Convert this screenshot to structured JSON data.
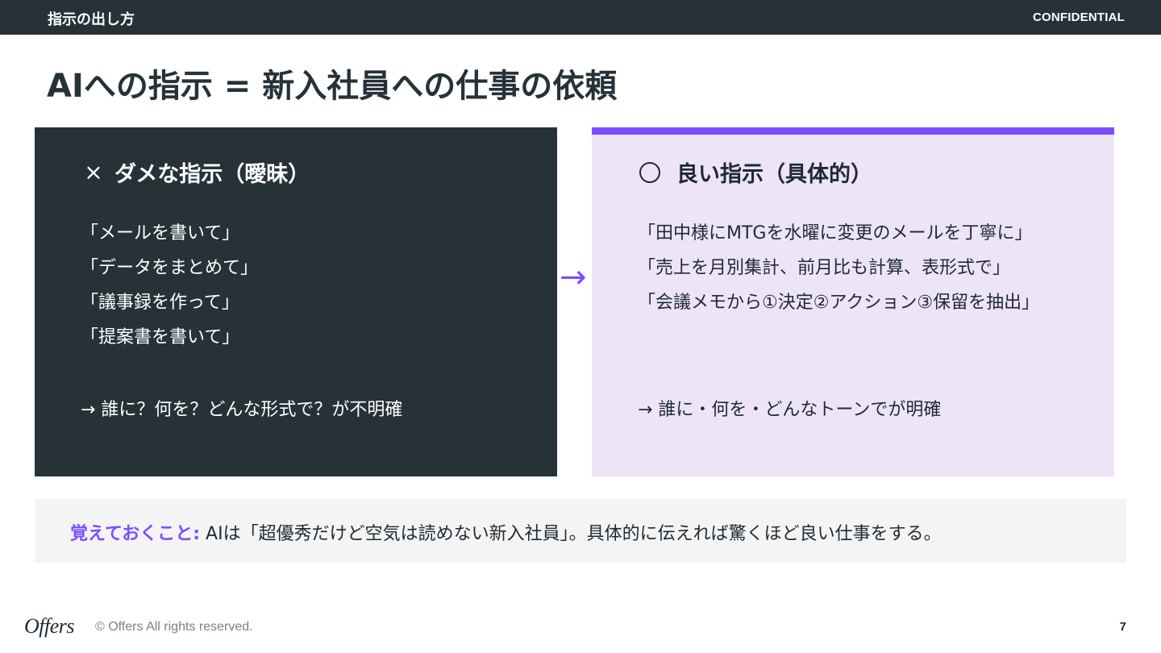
{
  "header": {
    "section": "指示の出し方",
    "label": "CONFIDENTIAL"
  },
  "title": "AIへの指示 = 新入社員への仕事の依頼",
  "bad": {
    "mark": "×",
    "heading": "ダメな指示（曖昧）",
    "quotes": [
      "「メールを書いて」",
      "「データをまとめて」",
      "「議事録を作って」",
      "「提案書を書いて」"
    ],
    "conclusion": "→ 誰に？何を？どんな形式で？が不明確"
  },
  "arrow": "→",
  "good": {
    "heading": "良い指示（具体的）",
    "quotes": [
      "「田中様にMTGを水曜に変更のメールを丁寧に」",
      "「売上を月別集計、前月比も計算、表形式で」",
      "「会議メモから①決定②アクション③保留を抽出」"
    ],
    "conclusion": "→ 誰に・何を・どんなトーンでが明確"
  },
  "memo": {
    "label": "覚えておくこと:",
    "text": " AIは「超優秀だけど空気は読めない新入社員」。具体的に伝えれば驚くほど良い仕事をする。"
  },
  "footer": {
    "logo": "Offers",
    "copyright": "© Offers All rights reserved.",
    "page": "7"
  },
  "colors": {
    "dark": "#263238",
    "accent": "#7c4dff",
    "good_bg": "#ede4f7",
    "memo_bg": "#f4f4f4"
  }
}
